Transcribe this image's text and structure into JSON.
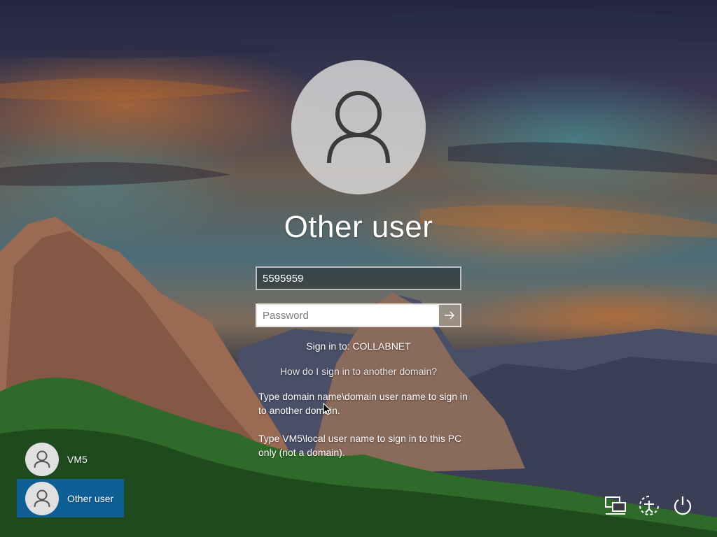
{
  "login": {
    "title": "Other user",
    "username_value": "5595959",
    "password_placeholder": "Password",
    "sign_in_to": "Sign in to: COLLABNET",
    "help_link": "How do I sign in to another domain?",
    "help_text_1": "Type domain name\\domain user name to sign in to another domain.",
    "help_text_2": "Type VM5\\local user name to sign in to this PC only (not a domain)."
  },
  "users": [
    {
      "label": "VM5",
      "active": false
    },
    {
      "label": "Other user",
      "active": true
    }
  ],
  "corner_icons": [
    "network-icon",
    "ease-of-access-icon",
    "power-icon"
  ],
  "colors": {
    "active_tile": "#0e5f96"
  }
}
